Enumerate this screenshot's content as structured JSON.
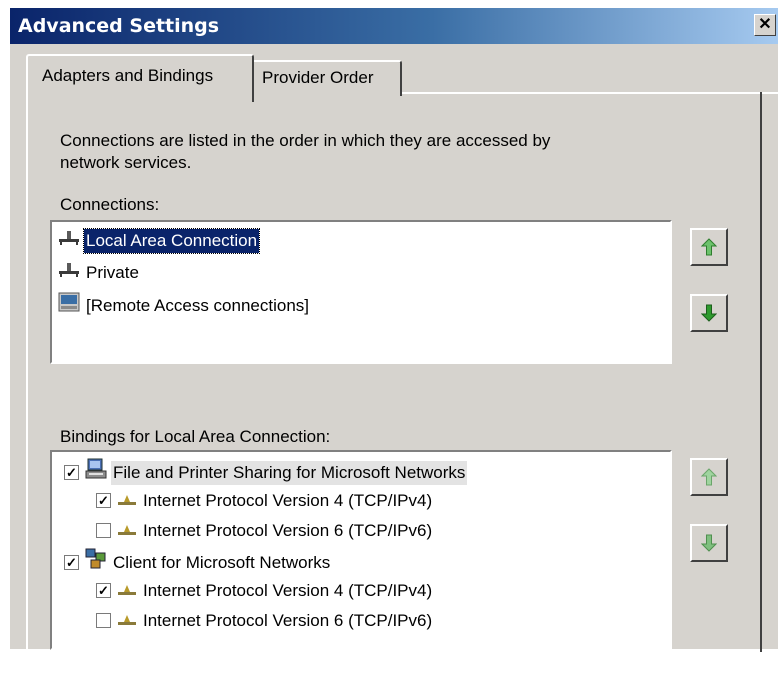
{
  "window": {
    "title": "Advanced Settings",
    "close_glyph": "✕"
  },
  "tabs": [
    {
      "label": "Adapters and Bindings",
      "active": true
    },
    {
      "label": "Provider Order",
      "active": false
    }
  ],
  "intro_text_line1": "Connections are listed in the order in which they are accessed by",
  "intro_text_line2": "network services.",
  "connections": {
    "label": "Connections:",
    "items": [
      {
        "label": "Local Area Connection",
        "icon": "network-connection-icon",
        "selected": true
      },
      {
        "label": "Private",
        "icon": "network-connection-icon",
        "selected": false
      },
      {
        "label": "[Remote Access connections]",
        "icon": "remote-access-icon",
        "selected": false
      }
    ]
  },
  "bindings": {
    "label": "Bindings for Local Area Connection:",
    "items": [
      {
        "label": "File and Printer Sharing for Microsoft Networks",
        "checked": true,
        "level": 0,
        "icon": "file-printer-sharing-icon"
      },
      {
        "label": "Internet Protocol Version 4 (TCP/IPv4)",
        "checked": true,
        "level": 1,
        "icon": "protocol-icon"
      },
      {
        "label": "Internet Protocol Version 6 (TCP/IPv6)",
        "checked": false,
        "level": 1,
        "icon": "protocol-icon"
      },
      {
        "label": "Client for Microsoft Networks",
        "checked": true,
        "level": 0,
        "icon": "client-networks-icon"
      },
      {
        "label": "Internet Protocol Version 4 (TCP/IPv4)",
        "checked": true,
        "level": 1,
        "icon": "protocol-icon"
      },
      {
        "label": "Internet Protocol Version 6 (TCP/IPv6)",
        "checked": false,
        "level": 1,
        "icon": "protocol-icon"
      }
    ]
  },
  "colors": {
    "title_bar": "#0a246a",
    "selection": "#0a246a",
    "move_up_arrow": "#6cc26c",
    "move_down_arrow": "#2e9a2e"
  }
}
